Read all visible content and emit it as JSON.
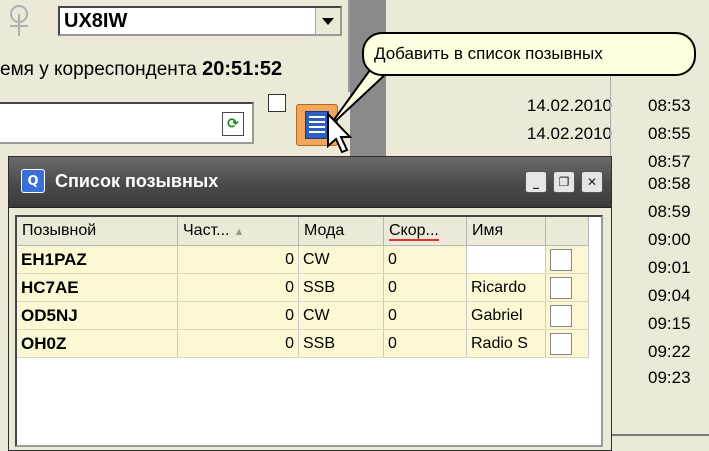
{
  "top": {
    "callsign_value": "UX8IW",
    "time_label": "емя у корреспондента",
    "time_value": "20:51:52"
  },
  "tooltip": {
    "text": "Добавить в список позывных"
  },
  "log": {
    "rows": [
      {
        "date": "14.02.2010",
        "time": "08:53"
      },
      {
        "date": "14.02.2010",
        "time": "08:55"
      },
      {
        "date": "",
        "time": "08:57"
      },
      {
        "date": "",
        "time": "08:58"
      },
      {
        "date": "",
        "time": "08:59"
      },
      {
        "date": "",
        "time": "09:00"
      },
      {
        "date": "",
        "time": "09:01"
      },
      {
        "date": "",
        "time": "09:04"
      },
      {
        "date": "",
        "time": "09:15"
      },
      {
        "date": "",
        "time": "09:22"
      },
      {
        "date": "",
        "time": "09:23"
      }
    ]
  },
  "window": {
    "title": "Список позывных",
    "columns": [
      "Позывной",
      "Част...",
      "Мода",
      "Скор...",
      "Имя",
      ""
    ],
    "rows": [
      {
        "call": "EH1PAZ",
        "freq": "0",
        "mode": "CW",
        "speed": "0",
        "name": ""
      },
      {
        "call": "HC7AE",
        "freq": "0",
        "mode": "SSB",
        "speed": "0",
        "name": "Ricardo"
      },
      {
        "call": "OD5NJ",
        "freq": "0",
        "mode": "CW",
        "speed": "0",
        "name": "Gabriel"
      },
      {
        "call": "OH0Z",
        "freq": "0",
        "mode": "SSB",
        "speed": "0",
        "name": "Radio S"
      }
    ]
  }
}
